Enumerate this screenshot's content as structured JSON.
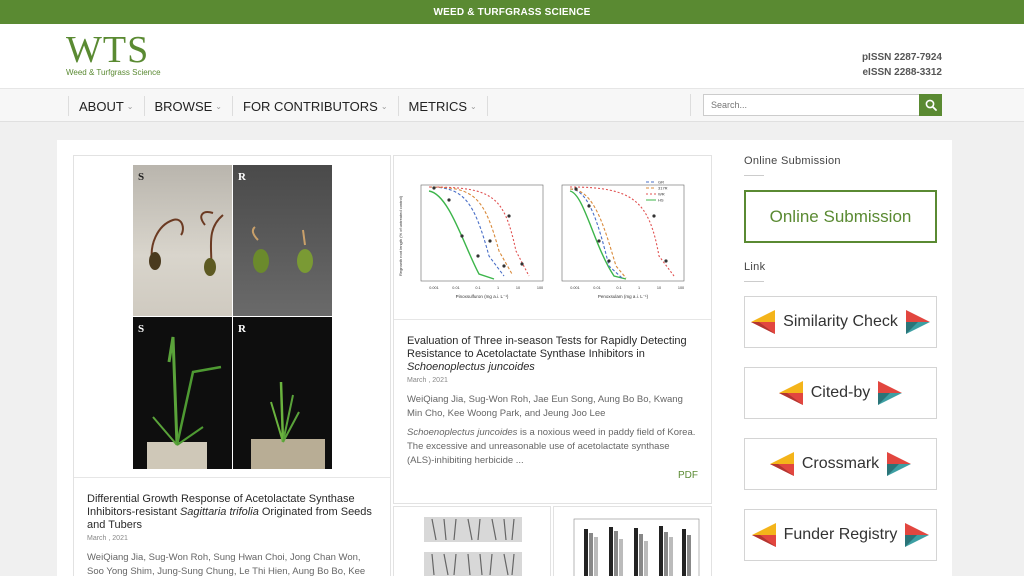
{
  "topbar": {
    "title": "WEED & TURFGRASS SCIENCE"
  },
  "header": {
    "logo_mark": "WTS",
    "logo_sub": "Weed & Turfgrass Science",
    "pissn": "pISSN 2287-7924",
    "eissn": "eISSN 2288-3312"
  },
  "nav": {
    "items": [
      {
        "label": "ABOUT"
      },
      {
        "label": "BROWSE"
      },
      {
        "label": "FOR CONTRIBUTORS"
      },
      {
        "label": "METRICS"
      }
    ],
    "search_placeholder": "Search..."
  },
  "articles": [
    {
      "title_prefix": "Differential Growth Response of Acetolactate Synthase Inhibitors-resistant ",
      "title_italic": "Sagittaria trifolia",
      "title_suffix": " Originated from Seeds and Tubers",
      "date": "March , 2021",
      "authors": "WeiQiang Jia, Sug-Won Roh, Sung Hwan Choi, Jong Chan Won, Soo Yong Shim, Jung-Sung Chung, Le Thi Hien, Aung Bo Bo, Kee Woong",
      "panel_labels": [
        "S",
        "R",
        "S",
        "R"
      ]
    },
    {
      "title_prefix": "Evaluation of Three in-season Tests for Rapidly Detecting Resistance to Acetolactate Synthase Inhibitors in ",
      "title_italic": "Schoenoplectus juncoides",
      "title_suffix": "",
      "date": "March , 2021",
      "authors": "WeiQiang Jia, Sug-Won Roh, Jae Eun Song, Aung Bo Bo, Kwang Min Cho, Kee Woong Park, and Jeung Joo Lee",
      "abstract_italic": "Schoenoplectus juncoides",
      "abstract_text": " is a noxious weed in paddy field of Korea. The excessive and unreasonable use of acetolactate synthase (ALS)-inhibiting herbicide ...",
      "pdf_label": "PDF",
      "figure": {
        "left_xlabel": "Pinoxsulfuron (mg a.i. L⁻¹)",
        "right_xlabel": "Penoxsulam (mg a.i. L⁻¹)",
        "ylabel": "Regrowth root length (% of untreated control)",
        "x_ticks": [
          "0.001",
          "0.01",
          "0.1",
          "1",
          "10",
          "100"
        ],
        "legend": [
          "GR",
          "317R",
          "WR",
          "HS"
        ],
        "colors": {
          "GR": "#4a6fc7",
          "317R": "#d98a3b",
          "WR": "#e05050",
          "HS": "#3cb54a"
        }
      }
    }
  ],
  "sidebar": {
    "submission_heading": "Online Submission",
    "submission_button": "Online Submission",
    "link_heading": "Link",
    "links": [
      {
        "label": "Similarity Check"
      },
      {
        "label": "Cited-by"
      },
      {
        "label": "Crossmark"
      },
      {
        "label": "Funder Registry"
      }
    ]
  },
  "colors": {
    "brand": "#5a8a32",
    "flag_yellow": "#f4b41a",
    "flag_red": "#e2463f",
    "flag_teal": "#3d9fa3"
  }
}
